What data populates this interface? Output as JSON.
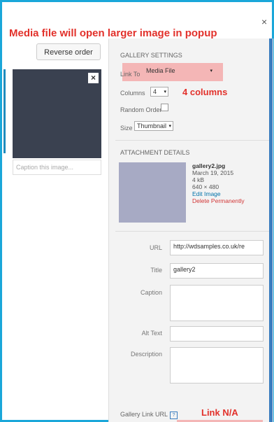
{
  "annotations": {
    "top": "Media file will open larger image in popup",
    "columns": "4 columns",
    "link_na": "Link N/A"
  },
  "modal": {
    "close_glyph": "×"
  },
  "left": {
    "reverse_label": "Reverse order",
    "caption_placeholder": "Caption this image..."
  },
  "gallery": {
    "title": "Gallery Settings",
    "link_to_label": "Link To",
    "link_to_value": "Media File",
    "columns_label": "Columns",
    "columns_value": "4",
    "random_label": "Random Order",
    "size_label": "Size",
    "size_value": "Thumbnail"
  },
  "attachment": {
    "title": "Attachment Details",
    "filename": "gallery2.jpg",
    "date": "March 19, 2015",
    "filesize": "4 kB",
    "dimensions": "640 × 480",
    "edit": "Edit Image",
    "delete": "Delete Permanently"
  },
  "fields": {
    "url_label": "URL",
    "url_value": "http://wdsamples.co.uk/re",
    "title_label": "Title",
    "title_value": "gallery2",
    "caption_label": "Caption",
    "alt_label": "Alt Text",
    "description_label": "Description",
    "gallery_link_label": "Gallery Link URL"
  },
  "colors": {
    "annotation": "#e2312b",
    "highlight": "#f4b6b6",
    "frame": "#1aa7d9"
  }
}
